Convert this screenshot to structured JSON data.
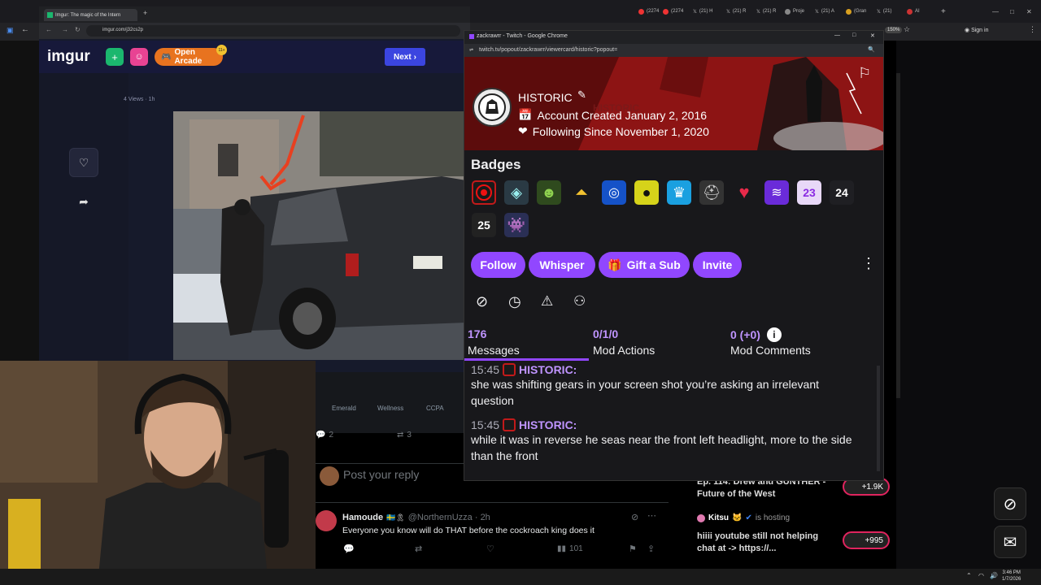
{
  "outer_browser": {
    "tabs": [
      "(2274",
      "(2274",
      "(21) H",
      "(21) R",
      "(21) R",
      "Proje",
      "(21) A",
      "(Gran",
      "(21) ",
      "AI"
    ],
    "zoom": "150%",
    "sign_in": "Sign in"
  },
  "imgur": {
    "tab_title": "Imgur: The magic of the Intern",
    "url": "imgur.com/j32cs2p",
    "logo": "imgur",
    "open_arcade": "Open Arcade",
    "arcade_badge": "11+",
    "next_button": "Next",
    "views": "4 Views · 1h",
    "footer_links": [
      "Emerald",
      "Wellness",
      "CCPA"
    ]
  },
  "twitter": {
    "reply_count": "2",
    "retweet_count": "3",
    "reply_placeholder": "Post your reply",
    "tweet": {
      "name": "Hamoude",
      "handle": "@NorthernUzza · 2h",
      "text": "Everyone you know will do THAT before the cockroach king does it",
      "views": "101"
    }
  },
  "right_column": {
    "item1_title": "Ep. 114: Drew and GUNTHER - Future of the West",
    "item1_count": "+1.9K",
    "host_name": "Kitsu",
    "host_status": "is hosting",
    "item2_text": "hiiii youtube still not helping chat at -> https://...",
    "item2_count": "+995"
  },
  "twitch_popup": {
    "window_title": "zackrawrr - Twitch - Google Chrome",
    "url": "twitch.tv/popout/zackrawrr/viewercard/historic?popout=",
    "username": "HISTORIC",
    "banner_watermark": "HISTORIC",
    "account_created": "Account Created January 2, 2016",
    "following_since": "Following Since November 1, 2020",
    "badges_heading": "Badges",
    "badge_texts": {
      "b2023": "23",
      "b2024": "24",
      "b2025": "25"
    },
    "buttons": {
      "follow": "Follow",
      "whisper": "Whisper",
      "gift": "Gift a Sub",
      "invite": "Invite"
    },
    "stats": [
      {
        "value": "176",
        "label": "Messages"
      },
      {
        "value": "0/1/0",
        "label": "Mod Actions"
      },
      {
        "value": "0 (+0)",
        "label": "Mod Comments"
      }
    ],
    "messages": [
      {
        "time": "15:45",
        "user": "HISTORIC:",
        "text": "she was shifting gears in your screen shot you’re asking an irrelevant question"
      },
      {
        "time": "15:45",
        "user": "HISTORIC:",
        "text": "while it was in reverse he seas near the front left headlight, more to the side than the front"
      }
    ]
  },
  "taskbar": {
    "time": "3:46 PM",
    "date": "1/7/2026"
  },
  "colors": {
    "twitch_purple": "#9147ff",
    "twitch_text_purple": "#bf94ff",
    "banner_red": "#8d1414",
    "imgur_green": "#1bb76e"
  }
}
